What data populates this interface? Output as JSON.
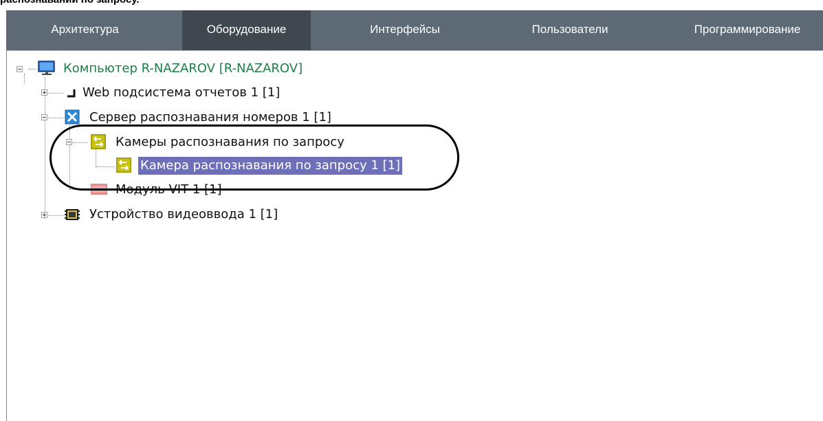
{
  "page_header": "распознавании по запросу.",
  "tabs": [
    {
      "label": "Архитектура",
      "active": false
    },
    {
      "label": "Оборудование",
      "active": true
    },
    {
      "label": "Интерфейсы",
      "active": false
    },
    {
      "label": "Пользователи",
      "active": false
    },
    {
      "label": "Программирование",
      "active": false
    }
  ],
  "tree": {
    "root": {
      "label": "Компьютер R-NAZAROV [R-NAZAROV]",
      "icon": "monitor-icon",
      "expanded": true
    },
    "web_subsystem": {
      "label": "Web подсистема отчетов 1 [1]",
      "icon": "web-report-icon",
      "expanded": false
    },
    "recognition_server": {
      "label": "Сервер распознавания номеров 1 [1]",
      "icon": "recognition-server-icon",
      "expanded": true
    },
    "on_request_cameras": {
      "label": "Камеры распознавания по запросу",
      "icon": "camera-switch-icon",
      "expanded": true
    },
    "on_request_camera": {
      "label": "Камера распознавания по запросу 1 [1]",
      "icon": "camera-switch-icon",
      "selected": true
    },
    "vit_module": {
      "label": "Модуль VIT 1 [1]",
      "icon": "vit-module-icon"
    },
    "video_input": {
      "label": "Устройство видеоввода 1 [1]",
      "icon": "video-input-icon",
      "expanded": false
    }
  },
  "colors": {
    "tabbar": "#5d6974",
    "active_tab": "#3f474f",
    "selection": "#6d6fb9",
    "root_text": "#1e7d46"
  }
}
